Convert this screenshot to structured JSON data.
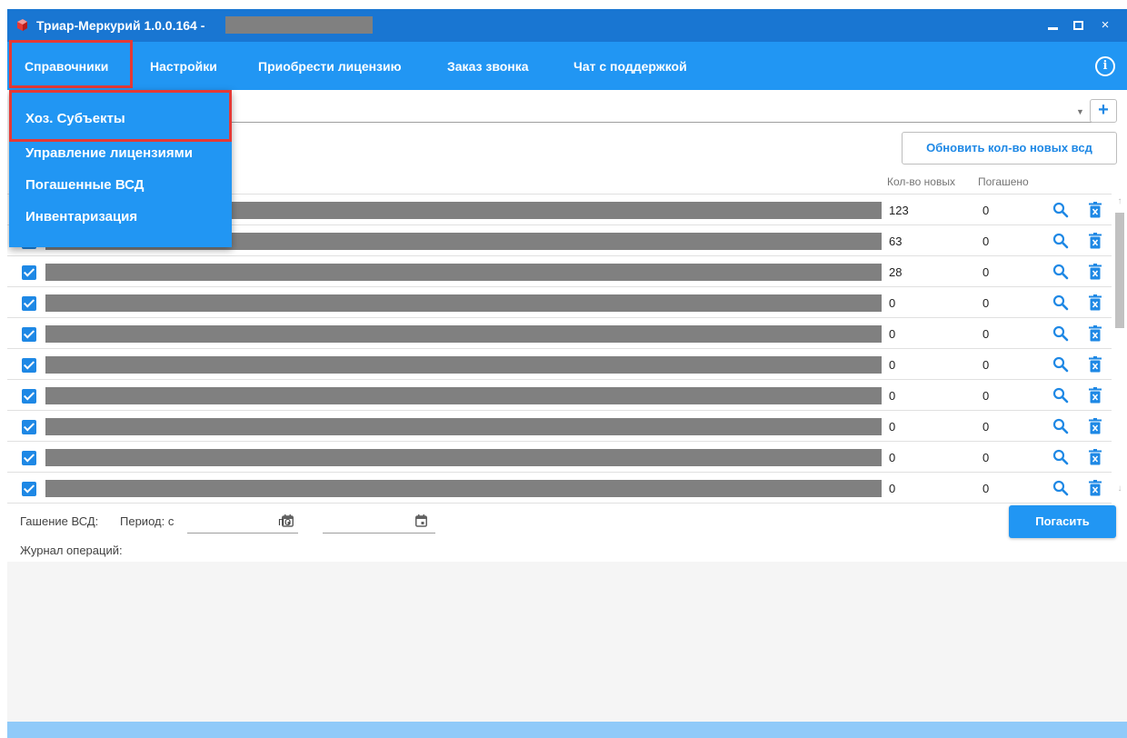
{
  "window": {
    "title": "Триар-Меркурий 1.0.0.164 -",
    "controls": {
      "minimize": "minimize",
      "maximize": "maximize",
      "close": "×"
    }
  },
  "menu": {
    "items": [
      "Справочники",
      "Настройки",
      "Приобрести лицензию",
      "Заказ звонка",
      "Чат с поддержкой"
    ],
    "active": "Справочники",
    "info_icon": "i"
  },
  "dropdown": {
    "items": [
      "Хоз. Субъекты",
      "Управление лицензиями",
      "Погашенные ВСД",
      "Инвентаризация"
    ],
    "highlighted": "Хоз. Субъекты"
  },
  "toolbar": {
    "add_label": "+",
    "refresh_label": "Обновить кол-во новых всд"
  },
  "table": {
    "columns": [
      "Кол-во новых",
      "Погашено"
    ],
    "rows": [
      {
        "checked": true,
        "new": "123",
        "paid": "0"
      },
      {
        "checked": true,
        "new": "63",
        "paid": "0"
      },
      {
        "checked": true,
        "new": "28",
        "paid": "0"
      },
      {
        "checked": true,
        "new": "0",
        "paid": "0"
      },
      {
        "checked": true,
        "new": "0",
        "paid": "0"
      },
      {
        "checked": true,
        "new": "0",
        "paid": "0"
      },
      {
        "checked": true,
        "new": "0",
        "paid": "0"
      },
      {
        "checked": true,
        "new": "0",
        "paid": "0"
      },
      {
        "checked": true,
        "new": "0",
        "paid": "0"
      },
      {
        "checked": true,
        "new": "0",
        "paid": "0"
      }
    ]
  },
  "footer": {
    "label": "Гашение ВСД:",
    "period_from": "Период: с",
    "period_to": "по",
    "pay_button": "Погасить",
    "log_label": "Журнал операций:"
  },
  "colors": {
    "titlebar": "#1976d2",
    "menubar": "#2196f3",
    "highlight_outline": "#e53935",
    "accent": "#1e88e5",
    "status_bar": "#90caf9"
  }
}
